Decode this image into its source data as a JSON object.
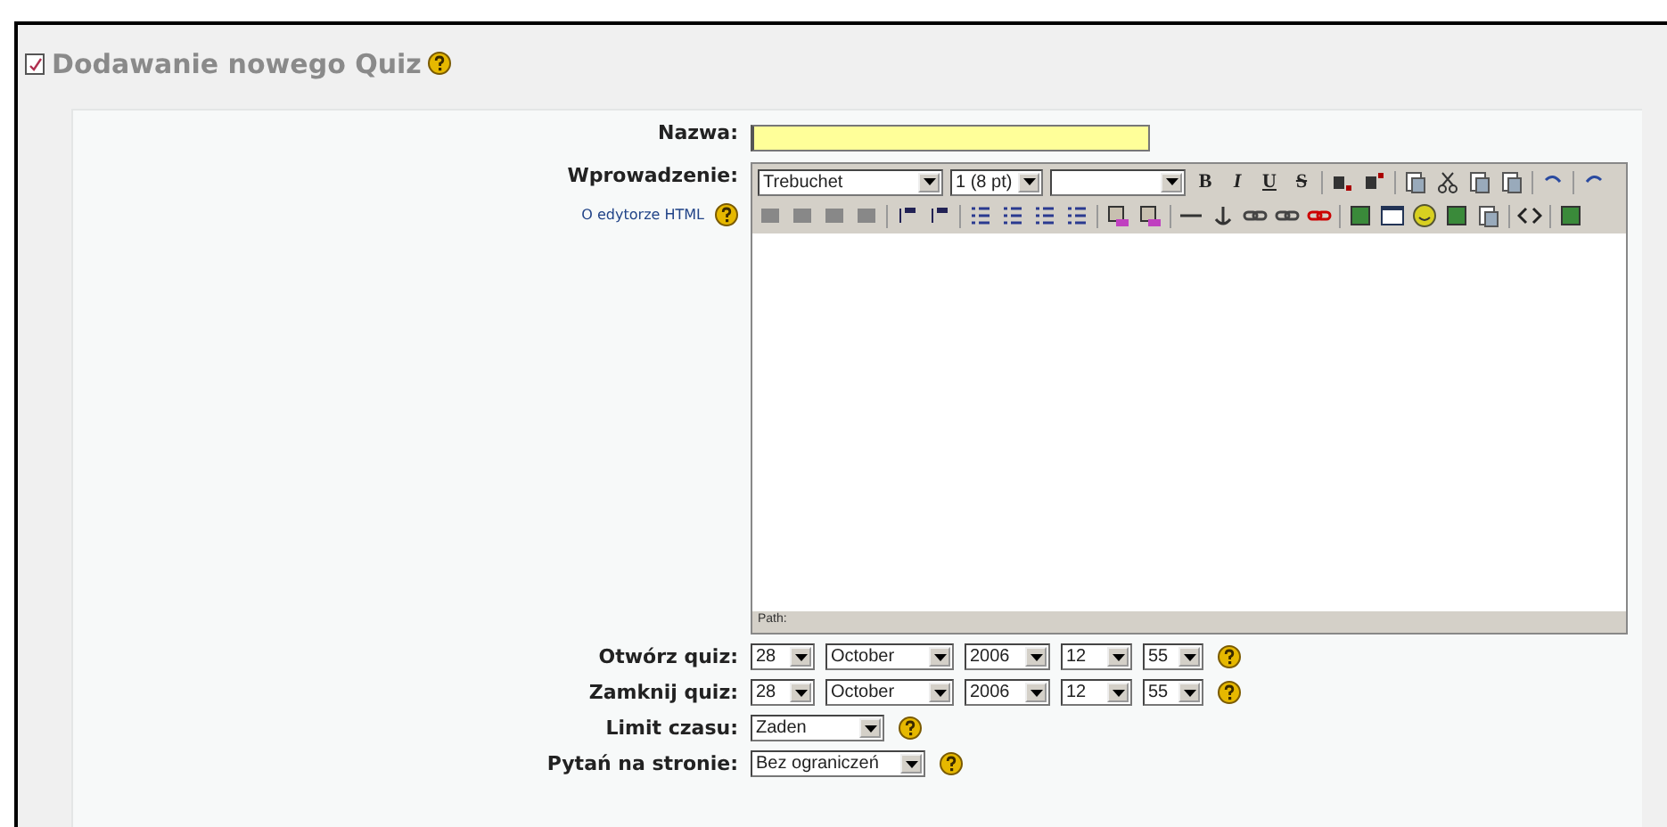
{
  "heading": {
    "title": "Dodawanie nowego Quiz"
  },
  "form": {
    "fields": [
      {
        "kind": "text",
        "label": "Nazwa:",
        "required": true
      },
      {
        "kind": "editor",
        "label": "Wprowadzenie:",
        "help_link": "O edytorze HTML",
        "font": "Trebuchet",
        "size": "1 (8 pt)",
        "format_buttons": [
          "B",
          "I",
          "U",
          "S"
        ],
        "path_label": "Path:"
      },
      {
        "kind": "datetime",
        "label": "Otwórz quiz:",
        "parts": [
          "28",
          "October",
          "2006",
          "12",
          "55"
        ]
      },
      {
        "kind": "datetime",
        "label": "Zamknij quiz:",
        "parts": [
          "28",
          "October",
          "2006",
          "12",
          "55"
        ]
      },
      {
        "kind": "select",
        "label": "Limit czasu:",
        "value": "Zaden"
      },
      {
        "kind": "select",
        "label": "Pytań na stronie:",
        "value": "Bez ograniczeń"
      }
    ]
  }
}
